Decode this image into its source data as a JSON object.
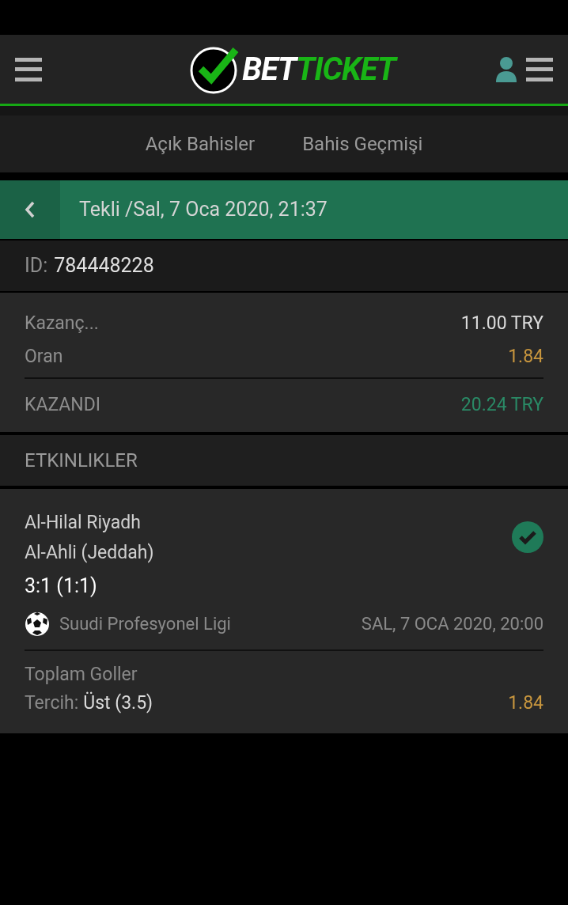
{
  "logo": {
    "part_1": "BET",
    "part_2": "TICKET"
  },
  "tabs": [
    {
      "label": "Açık Bahisler"
    },
    {
      "label": "Bahis Geçmişi"
    }
  ],
  "ticket_header": {
    "title": "Tekli /Sal, 7 Oca 2020, 21:37"
  },
  "ticket_id": {
    "label": "ID:",
    "value": "784448228"
  },
  "summary": [
    {
      "label": "Kazanç...",
      "value": "11.00 TRY",
      "kind": "plain"
    },
    {
      "label": "Oran",
      "value": "1.84",
      "kind": "odds"
    }
  ],
  "result": {
    "label": "KAZANDI",
    "value": "20.24 TRY"
  },
  "events_heading": "ETKINLIKLER",
  "events": [
    {
      "home": "Al-Hilal Riyadh",
      "away": "Al-Ahli (Jeddah)",
      "score": "3:1 (1:1)",
      "won": true,
      "league": "Suudi Profesyonel Ligi",
      "date": "SAL, 7 OCA 2020, 20:00",
      "market": "Toplam Goller",
      "choice_label": "Tercih:",
      "choice": "Üst (3.5)",
      "odds": "1.84"
    }
  ]
}
